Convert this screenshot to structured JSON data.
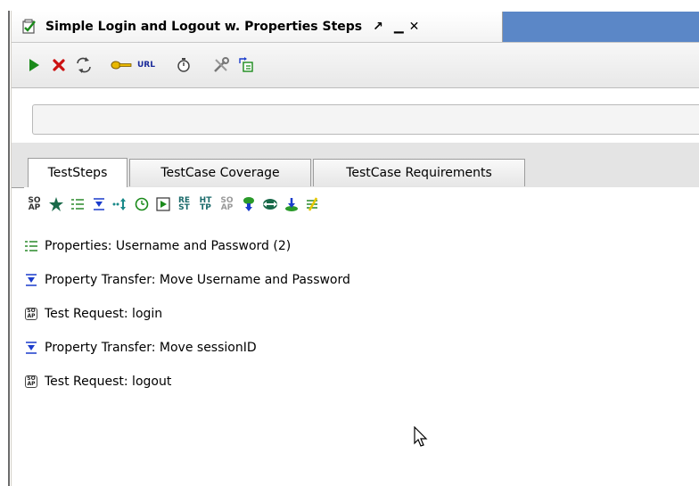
{
  "window": {
    "title": "Simple Login and Logout w. Properties Steps",
    "controls": {
      "restore": "↗",
      "minimize": "▁",
      "close": "✕"
    }
  },
  "toolbar": {
    "buttons": [
      "run-icon",
      "cancel-icon",
      "loop-icon",
      "key-icon",
      "url-icon",
      "timer-icon",
      "tools-icon",
      "export-icon"
    ],
    "url_label": "URL"
  },
  "progress": {
    "value": 0,
    "text": ""
  },
  "tabs": [
    {
      "label": "TestSteps",
      "active": true
    },
    {
      "label": "TestCase Coverage",
      "active": false
    },
    {
      "label": "TestCase Requirements",
      "active": false
    }
  ],
  "step_toolbar": {
    "soap_label": "SO\nAP",
    "rest_label": "RE\nST",
    "http_label": "HT\nTP",
    "amf_label": "SO\nAP",
    "buttons": [
      "soap-request-icon",
      "star-icon",
      "properties-icon",
      "property-transfer-icon",
      "conditional-goto-icon",
      "delay-icon",
      "run-testcase-icon",
      "rest-request-icon",
      "http-request-icon",
      "amf-request-icon",
      "jdbc-request-icon",
      "mock-response-icon",
      "datasource-icon",
      "manual-step-icon"
    ]
  },
  "steps": [
    {
      "label": "Properties: Username and Password (2)",
      "icon": "properties-icon"
    },
    {
      "label": "Property Transfer: Move Username and Password",
      "icon": "property-transfer-icon"
    },
    {
      "label": "Test Request: login",
      "icon": "soap-request-icon"
    },
    {
      "label": "Property Transfer: Move sessionID",
      "icon": "property-transfer-icon"
    },
    {
      "label": "Test Request: logout",
      "icon": "soap-request-icon"
    }
  ],
  "colors": {
    "title_accent": "#5b87c7",
    "run_green": "#1a8a1a",
    "cancel_red": "#cc1111",
    "transfer_blue": "#1a3ccc"
  }
}
